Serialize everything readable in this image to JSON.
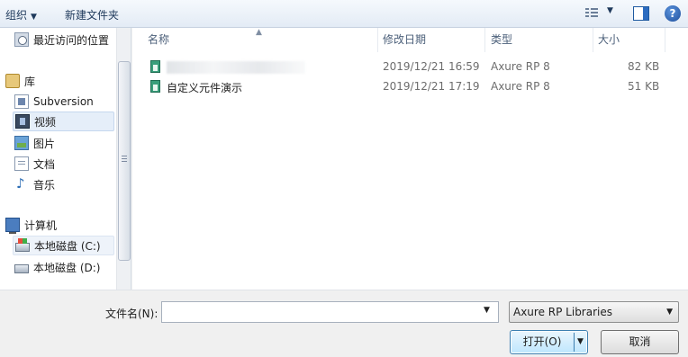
{
  "toolbar": {
    "organize_label": "组织",
    "new_folder_label": "新建文件夹",
    "help_label": "?"
  },
  "nav": {
    "items": [
      {
        "label": "最近访问的位置",
        "icon": "recent-places-icon"
      },
      {
        "label": "库",
        "icon": "libraries-icon"
      },
      {
        "label": "Subversion",
        "icon": "subversion-icon"
      },
      {
        "label": "视频",
        "icon": "videos-icon"
      },
      {
        "label": "图片",
        "icon": "pictures-icon"
      },
      {
        "label": "文档",
        "icon": "documents-icon"
      },
      {
        "label": "音乐",
        "icon": "music-icon"
      },
      {
        "label": "计算机",
        "icon": "computer-icon"
      },
      {
        "label": "本地磁盘 (C:)",
        "icon": "drive-c-icon"
      },
      {
        "label": "本地磁盘 (D:)",
        "icon": "drive-d-icon"
      }
    ]
  },
  "filelist": {
    "columns": [
      "名称",
      "修改日期",
      "类型",
      "大小"
    ],
    "rows": [
      {
        "name": "",
        "date": "2019/12/21 16:59",
        "type": "Axure RP 8",
        "size": "82 KB"
      },
      {
        "name": "自定义元件演示",
        "date": "2019/12/21 17:19",
        "type": "Axure RP 8",
        "size": "51 KB"
      }
    ]
  },
  "bottom": {
    "filename_label": "文件名(N):",
    "filename_value": "",
    "file_type_value": "Axure RP Libraries",
    "open_label": "打开(O)",
    "cancel_label": "取消"
  }
}
